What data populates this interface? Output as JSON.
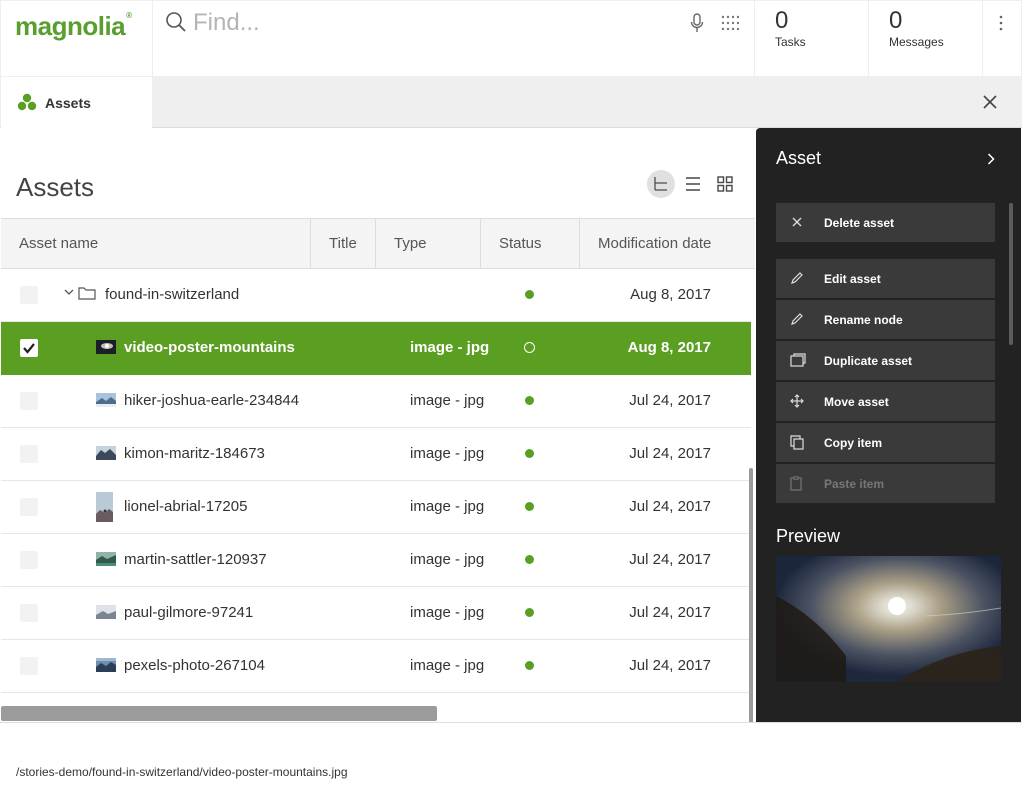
{
  "brand": {
    "name": "magnolia",
    "mark": "®",
    "color": "#599e2f"
  },
  "search": {
    "placeholder": "Find..."
  },
  "header": {
    "tasks": {
      "count": "0",
      "label": "Tasks"
    },
    "messages": {
      "count": "0",
      "label": "Messages"
    }
  },
  "tab": {
    "label": "Assets",
    "icon": "assets-icon"
  },
  "main": {
    "title": "Assets",
    "view_modes": [
      "tree-view-icon",
      "list-view-icon",
      "grid-view-icon"
    ],
    "active_view": "tree"
  },
  "table": {
    "columns": [
      "Asset name",
      "Title",
      "Type",
      "Status",
      "Modification date"
    ],
    "rows": [
      {
        "name": "found-in-switzerland",
        "type": "",
        "status": "published",
        "date": "Aug 8, 2017",
        "kind": "folder",
        "selected": false
      },
      {
        "name": "video-poster-mountains",
        "type": "image - jpg",
        "status": "modified",
        "date": "Aug 8, 2017",
        "kind": "image",
        "selected": true
      },
      {
        "name": "hiker-joshua-earle-234844",
        "type": "image - jpg",
        "status": "published",
        "date": "Jul 24, 2017",
        "kind": "image",
        "selected": false
      },
      {
        "name": "kimon-maritz-184673",
        "type": "image - jpg",
        "status": "published",
        "date": "Jul 24, 2017",
        "kind": "image",
        "selected": false
      },
      {
        "name": "lionel-abrial-17205",
        "type": "image - jpg",
        "status": "published",
        "date": "Jul 24, 2017",
        "kind": "image",
        "selected": false
      },
      {
        "name": "martin-sattler-120937",
        "type": "image - jpg",
        "status": "published",
        "date": "Jul 24, 2017",
        "kind": "image",
        "selected": false
      },
      {
        "name": "paul-gilmore-97241",
        "type": "image - jpg",
        "status": "published",
        "date": "Jul 24, 2017",
        "kind": "image",
        "selected": false
      },
      {
        "name": "pexels-photo-267104",
        "type": "image - jpg",
        "status": "published",
        "date": "Jul 24, 2017",
        "kind": "image",
        "selected": false
      }
    ]
  },
  "panel": {
    "title": "Asset",
    "actions": [
      {
        "label": "Delete asset",
        "icon": "close-icon",
        "enabled": true
      },
      {
        "label": "Edit asset",
        "icon": "pencil-icon",
        "enabled": true
      },
      {
        "label": "Rename node",
        "icon": "pencil-icon",
        "enabled": true
      },
      {
        "label": "Duplicate asset",
        "icon": "duplicate-icon",
        "enabled": true
      },
      {
        "label": "Move asset",
        "icon": "move-icon",
        "enabled": true
      },
      {
        "label": "Copy item",
        "icon": "copy-icon",
        "enabled": true
      },
      {
        "label": "Paste item",
        "icon": "clipboard-icon",
        "enabled": false
      }
    ],
    "preview_title": "Preview"
  },
  "footer": {
    "path": "/stories-demo/found-in-switzerland/video-poster-mountains.jpg"
  },
  "colors": {
    "accent": "#5a9e22",
    "panel_bg": "#222222",
    "action_bg": "#3a3a3a"
  }
}
